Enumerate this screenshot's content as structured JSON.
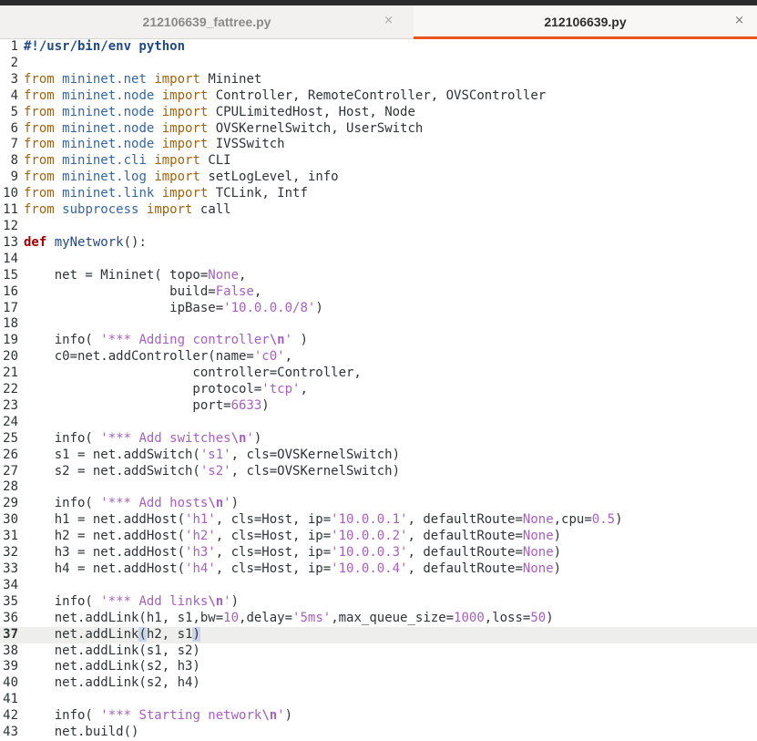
{
  "tabs": [
    {
      "label": "212106639_fattree.py",
      "active": false,
      "close": "×"
    },
    {
      "label": "212106639.py",
      "active": true,
      "close": "×"
    }
  ],
  "current_line": 37,
  "lines": [
    {
      "n": "1",
      "html": "<span class='shebang'>#!/usr/bin/env python</span>"
    },
    {
      "n": "2",
      "html": ""
    },
    {
      "n": "3",
      "html": "<span class='kw'>from</span> <span class='mod'>mininet.net</span> <span class='kw'>import</span> Mininet"
    },
    {
      "n": "4",
      "html": "<span class='kw'>from</span> <span class='mod'>mininet.node</span> <span class='kw'>import</span> Controller, RemoteController, OVSController"
    },
    {
      "n": "5",
      "html": "<span class='kw'>from</span> <span class='mod'>mininet.node</span> <span class='kw'>import</span> CPULimitedHost, Host, Node"
    },
    {
      "n": "6",
      "html": "<span class='kw'>from</span> <span class='mod'>mininet.node</span> <span class='kw'>import</span> OVSKernelSwitch, UserSwitch"
    },
    {
      "n": "7",
      "html": "<span class='kw'>from</span> <span class='mod'>mininet.node</span> <span class='kw'>import</span> IVSSwitch"
    },
    {
      "n": "8",
      "html": "<span class='kw'>from</span> <span class='mod'>mininet.cli</span> <span class='kw'>import</span> CLI"
    },
    {
      "n": "9",
      "html": "<span class='kw'>from</span> <span class='mod'>mininet.log</span> <span class='kw'>import</span> setLogLevel, info"
    },
    {
      "n": "10",
      "html": "<span class='kw'>from</span> <span class='mod'>mininet.link</span> <span class='kw'>import</span> TCLink, Intf"
    },
    {
      "n": "11",
      "html": "<span class='kw'>from</span> <span class='mod'>subprocess</span> <span class='kw'>import</span> call"
    },
    {
      "n": "12",
      "html": ""
    },
    {
      "n": "13",
      "html": "<span class='kwd'>def</span> <span class='fn'>myNetwork</span>():"
    },
    {
      "n": "14",
      "html": ""
    },
    {
      "n": "15",
      "html": "    net = Mininet( topo=<span class='const'>None</span>,"
    },
    {
      "n": "16",
      "html": "                   build=<span class='const'>False</span>,"
    },
    {
      "n": "17",
      "html": "                   ipBase=<span class='str'>'10.0.0.0/8'</span>)"
    },
    {
      "n": "18",
      "html": ""
    },
    {
      "n": "19",
      "html": "    info( <span class='str'>'*** Adding controller<b>\\n</b>'</span> )"
    },
    {
      "n": "20",
      "html": "    c0=net.addController(name=<span class='str'>'c0'</span>,"
    },
    {
      "n": "21",
      "html": "                      controller=Controller,"
    },
    {
      "n": "22",
      "html": "                      protocol=<span class='str'>'tcp'</span>,"
    },
    {
      "n": "23",
      "html": "                      port=<span class='num'>6633</span>)"
    },
    {
      "n": "24",
      "html": ""
    },
    {
      "n": "25",
      "html": "    info( <span class='str'>'*** Add switches<b>\\n</b>'</span>)"
    },
    {
      "n": "26",
      "html": "    s1 = net.addSwitch(<span class='str'>'s1'</span>, cls=OVSKernelSwitch)"
    },
    {
      "n": "27",
      "html": "    s2 = net.addSwitch(<span class='str'>'s2'</span>, cls=OVSKernelSwitch)"
    },
    {
      "n": "28",
      "html": ""
    },
    {
      "n": "29",
      "html": "    info( <span class='str'>'*** Add hosts<b>\\n</b>'</span>)"
    },
    {
      "n": "30",
      "html": "    h1 = net.addHost(<span class='str'>'h1'</span>, cls=Host, ip=<span class='str'>'10.0.0.1'</span>, defaultRoute=<span class='const'>None</span>,cpu=<span class='num'>0.5</span>)"
    },
    {
      "n": "31",
      "html": "    h2 = net.addHost(<span class='str'>'h2'</span>, cls=Host, ip=<span class='str'>'10.0.0.2'</span>, defaultRoute=<span class='const'>None</span>)"
    },
    {
      "n": "32",
      "html": "    h3 = net.addHost(<span class='str'>'h3'</span>, cls=Host, ip=<span class='str'>'10.0.0.3'</span>, defaultRoute=<span class='const'>None</span>)"
    },
    {
      "n": "33",
      "html": "    h4 = net.addHost(<span class='str'>'h4'</span>, cls=Host, ip=<span class='str'>'10.0.0.4'</span>, defaultRoute=<span class='const'>None</span>)"
    },
    {
      "n": "34",
      "html": ""
    },
    {
      "n": "35",
      "html": "    info( <span class='str'>'*** Add links<b>\\n</b>'</span>)"
    },
    {
      "n": "36",
      "html": "    net.addLink(h1, s1,bw=<span class='num'>10</span>,delay=<span class='str'>'5ms'</span>,max_queue_size=<span class='num'>1000</span>,loss=<span class='num'>50</span>)"
    },
    {
      "n": "37",
      "html": "    net.addLink<span class='paren-hl'>(</span>h2, s1<span class='paren-hl'>)</span>"
    },
    {
      "n": "38",
      "html": "    net.addLink(s1, s2)"
    },
    {
      "n": "39",
      "html": "    net.addLink(s2, h3)"
    },
    {
      "n": "40",
      "html": "    net.addLink(s2, h4)"
    },
    {
      "n": "41",
      "html": ""
    },
    {
      "n": "42",
      "html": "    info( <span class='str'>'*** Starting network<b>\\n</b>'</span>)"
    },
    {
      "n": "43",
      "html": "    net.build()"
    }
  ]
}
